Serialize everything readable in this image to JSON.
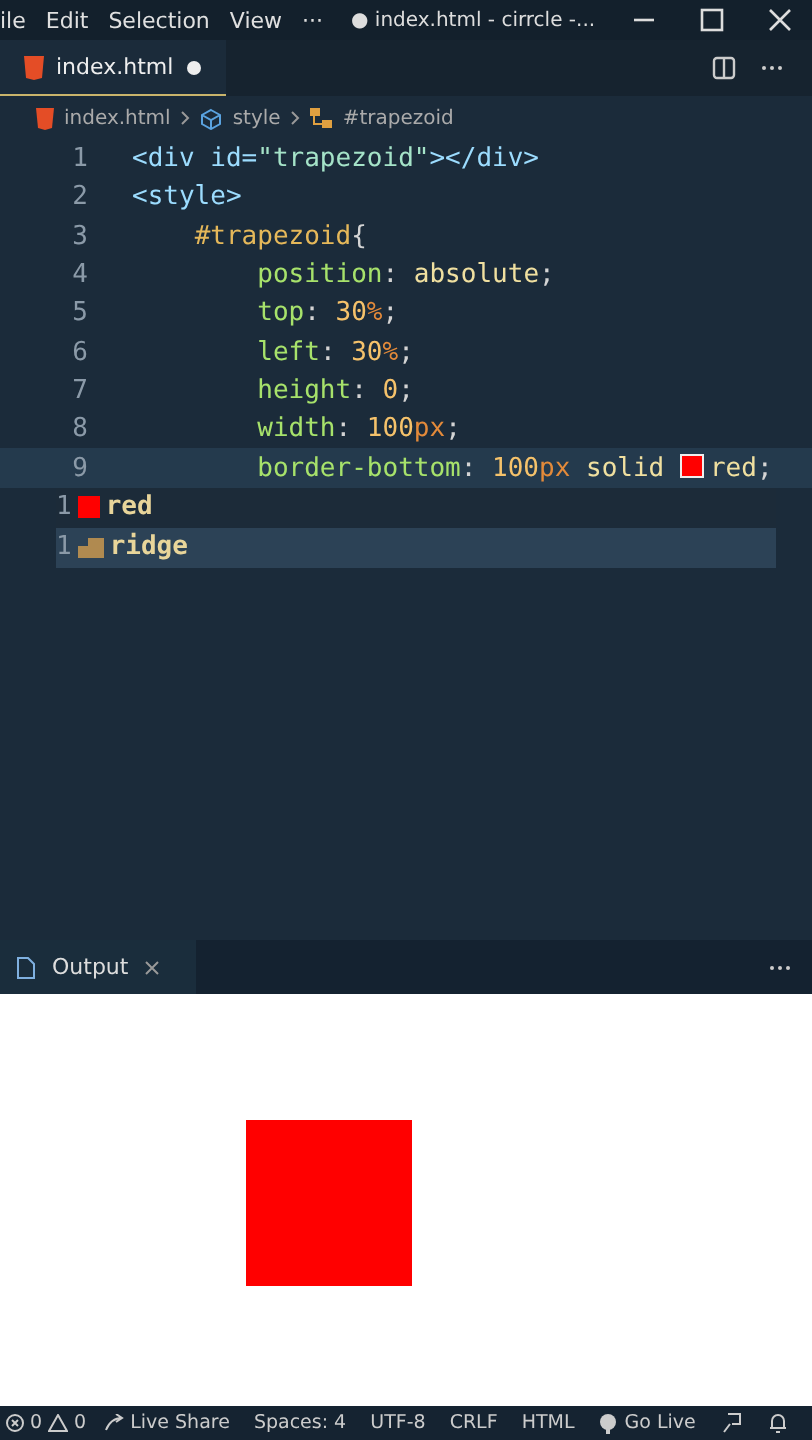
{
  "menu": [
    "ile",
    "Edit",
    "Selection",
    "View",
    "···"
  ],
  "window": {
    "title": "● index.html - cirrcle -..."
  },
  "tabs": [
    {
      "label": "index.html",
      "dirty": true,
      "selected": true
    }
  ],
  "breadcrumbs": [
    {
      "label": "index.html",
      "kind": "file"
    },
    {
      "label": "style",
      "kind": "element"
    },
    {
      "label": "#trapezoid",
      "kind": "selector"
    }
  ],
  "code": [
    {
      "number": "1",
      "current": false,
      "text": "<div id=\"trapezoid\"></div>"
    },
    {
      "number": "2",
      "current": false,
      "text": "<style>"
    },
    {
      "number": "3",
      "current": false,
      "text": "    #trapezoid{"
    },
    {
      "number": "4",
      "current": false,
      "text": "        position: absolute;"
    },
    {
      "number": "5",
      "current": false,
      "text": "        top: 30%;"
    },
    {
      "number": "6",
      "current": false,
      "text": "        left: 30%;"
    },
    {
      "number": "7",
      "current": false,
      "text": "        height: 0;"
    },
    {
      "number": "8",
      "current": false,
      "text": "        width: 100px;"
    },
    {
      "number": "9",
      "current": true,
      "text": "        border-bottom: 100px solid ",
      "color": "#ff0000",
      "text_after": "red;"
    }
  ],
  "suggestions": [
    {
      "line_number": "1",
      "label": "red",
      "kind": "color",
      "color": "#ff0000",
      "selected": false
    },
    {
      "line_number": "1",
      "label": "ridge",
      "kind": "keyword",
      "selected": true
    }
  ],
  "panel": {
    "tab": "Output"
  },
  "status_bar": {
    "errors": "0",
    "warnings": "0",
    "items": [
      "Live Share",
      "Spaces: 4",
      "UTF-8",
      "CRLF",
      "HTML",
      "Go Live"
    ]
  }
}
